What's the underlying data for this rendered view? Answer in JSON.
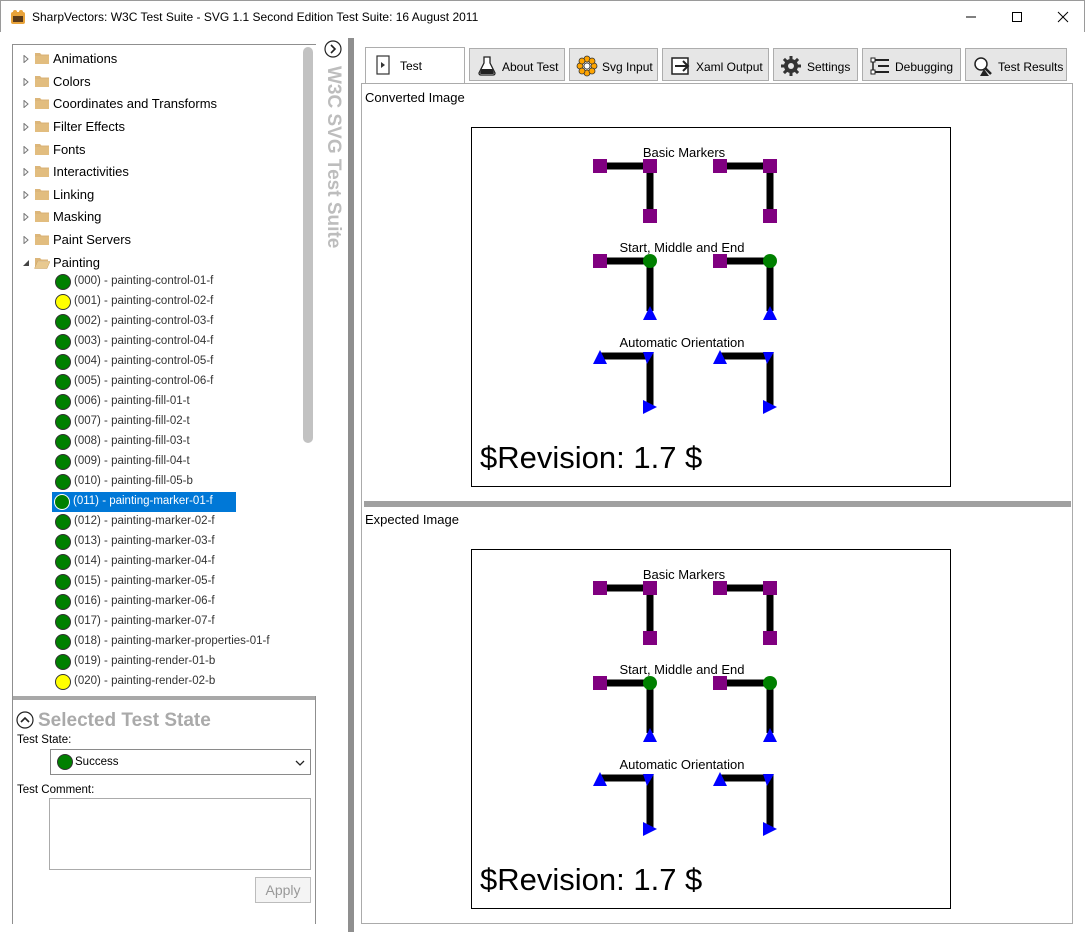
{
  "window": {
    "title": "SharpVectors: W3C Test Suite - SVG 1.1 Second Edition Test Suite: 16 August 2011"
  },
  "tree": {
    "folders": [
      {
        "label": "Animations",
        "expanded": false
      },
      {
        "label": "Colors",
        "expanded": false
      },
      {
        "label": "Coordinates and Transforms",
        "expanded": false
      },
      {
        "label": "Filter Effects",
        "expanded": false
      },
      {
        "label": "Fonts",
        "expanded": false
      },
      {
        "label": "Interactivities",
        "expanded": false
      },
      {
        "label": "Linking",
        "expanded": false
      },
      {
        "label": "Masking",
        "expanded": false
      },
      {
        "label": "Paint Servers",
        "expanded": false
      },
      {
        "label": "Painting",
        "expanded": true
      }
    ],
    "items": [
      {
        "label": "(000) - painting-control-01-f",
        "status": "success"
      },
      {
        "label": "(001) - painting-control-02-f",
        "status": "partial"
      },
      {
        "label": "(002) - painting-control-03-f",
        "status": "success"
      },
      {
        "label": "(003) - painting-control-04-f",
        "status": "success"
      },
      {
        "label": "(004) - painting-control-05-f",
        "status": "success"
      },
      {
        "label": "(005) - painting-control-06-f",
        "status": "success"
      },
      {
        "label": "(006) - painting-fill-01-t",
        "status": "success"
      },
      {
        "label": "(007) - painting-fill-02-t",
        "status": "success"
      },
      {
        "label": "(008) - painting-fill-03-t",
        "status": "success"
      },
      {
        "label": "(009) - painting-fill-04-t",
        "status": "success"
      },
      {
        "label": "(010) - painting-fill-05-b",
        "status": "success"
      },
      {
        "label": "(011) - painting-marker-01-f",
        "status": "success",
        "selected": true
      },
      {
        "label": "(012) - painting-marker-02-f",
        "status": "success"
      },
      {
        "label": "(013) - painting-marker-03-f",
        "status": "success"
      },
      {
        "label": "(014) - painting-marker-04-f",
        "status": "success"
      },
      {
        "label": "(015) - painting-marker-05-f",
        "status": "success"
      },
      {
        "label": "(016) - painting-marker-06-f",
        "status": "success"
      },
      {
        "label": "(017) - painting-marker-07-f",
        "status": "success"
      },
      {
        "label": "(018) - painting-marker-properties-01-f",
        "status": "success"
      },
      {
        "label": "(019) - painting-render-01-b",
        "status": "success"
      },
      {
        "label": "(020) - painting-render-02-b",
        "status": "partial"
      }
    ]
  },
  "state_panel": {
    "title": "Selected Test State",
    "state_label": "Test State:",
    "state_value": "Success",
    "comment_label": "Test Comment:",
    "comment_value": "",
    "apply_label": "Apply"
  },
  "side_strip": {
    "text": "W3C SVG Test Suite"
  },
  "tabs": [
    {
      "label": "Test",
      "icon": "test-page-icon",
      "active": true
    },
    {
      "label": "About Test",
      "icon": "flask-icon",
      "active": false
    },
    {
      "label": "Svg Input",
      "icon": "svg-input-icon",
      "active": false
    },
    {
      "label": "Xaml Output",
      "icon": "export-icon",
      "active": false
    },
    {
      "label": "Settings",
      "icon": "gear-icon",
      "active": false
    },
    {
      "label": "Debugging",
      "icon": "debug-icon",
      "active": false
    },
    {
      "label": "Test Results",
      "icon": "test-results-icon",
      "active": false
    }
  ],
  "content": {
    "converted_label": "Converted Image",
    "expected_label": "Expected Image",
    "svg": {
      "heading_basic": "Basic Markers",
      "heading_sme": "Start, Middle and End",
      "heading_auto": "Automatic Orientation",
      "revision": "$Revision: 1.7 $"
    }
  },
  "colors": {
    "success": "#008000",
    "partial": "#ffff00",
    "selection": "#0078d7",
    "marker_purple": "#800080",
    "marker_green": "#008000",
    "marker_blue": "#0000ff",
    "folder": "#dcb67a"
  }
}
